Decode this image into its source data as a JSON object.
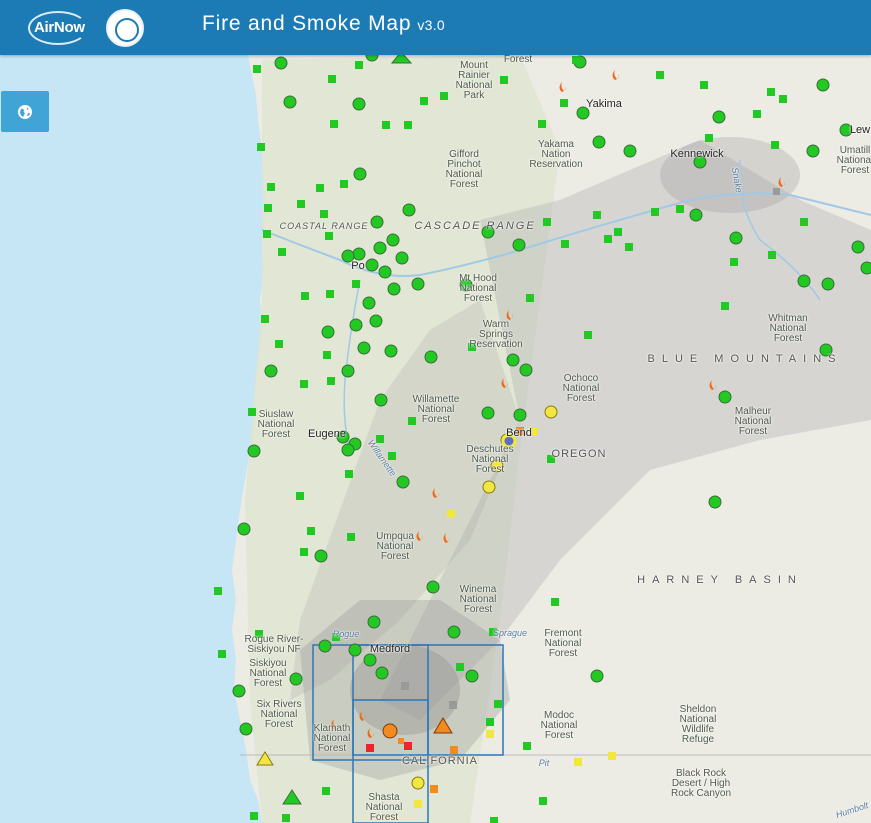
{
  "header": {
    "title": "Fire and Smoke Map",
    "version": "v3.0",
    "logo_airnow": "AirNow",
    "logo_agency": "agency seal"
  },
  "controls": {
    "basemap_button_icon": "globe-icon"
  },
  "colors": {
    "header": "#1c7bb4",
    "water": "#c6e6f5",
    "land": "#ecebe4",
    "smoke": "#a9a9a9",
    "good": "#22c922",
    "moderate": "#f2e640",
    "usg": "#f28a1e",
    "unhealthy": "#e8262b",
    "aoi": "#2b76b8"
  },
  "map": {
    "labels": [
      {
        "kind": "park",
        "text": "Mount\nRainier\nNational\nPark"
      },
      {
        "kind": "park",
        "text": "Snoqualmie\nNational\nForest"
      },
      {
        "kind": "city",
        "text": "Yakima"
      },
      {
        "kind": "park",
        "text": "Gifford\nPinchot\nNational\nForest"
      },
      {
        "kind": "park",
        "text": "Yakama\nNation\nReservation"
      },
      {
        "kind": "city",
        "text": "Kennewick"
      },
      {
        "kind": "city",
        "text": "Lew"
      },
      {
        "kind": "park",
        "text": "Umatill\nNational\nForest"
      },
      {
        "kind": "region2",
        "text": "COASTAL RANGE"
      },
      {
        "kind": "region2",
        "text": "CASCADE RANGE"
      },
      {
        "kind": "city",
        "text": "Po"
      },
      {
        "kind": "park",
        "text": "Mt Hood\nNational\nForest"
      },
      {
        "kind": "park",
        "text": "Warm\nSprings\nReservation"
      },
      {
        "kind": "park",
        "text": "Whitman\nNational\nForest"
      },
      {
        "kind": "region",
        "text": "BLUE MOUNTAINS"
      },
      {
        "kind": "park",
        "text": "Ochoco\nNational\nForest"
      },
      {
        "kind": "park",
        "text": "Malheur\nNational\nForest"
      },
      {
        "kind": "park",
        "text": "Siuslaw\nNational\nForest"
      },
      {
        "kind": "park",
        "text": "Willamette\nNational\nForest"
      },
      {
        "kind": "city",
        "text": "Eugene"
      },
      {
        "kind": "park",
        "text": "Deschutes\nNational\nForest"
      },
      {
        "kind": "state",
        "text": "OREGON"
      },
      {
        "kind": "park",
        "text": "Umpqua\nNational\nForest"
      },
      {
        "kind": "region",
        "text": "HARNEY BASIN"
      },
      {
        "kind": "park",
        "text": "Winema\nNational\nForest"
      },
      {
        "kind": "park",
        "text": "Fremont\nNational\nForest"
      },
      {
        "kind": "park",
        "text": "Rogue River-\nSiskiyou NF"
      },
      {
        "kind": "city",
        "text": "Medford"
      },
      {
        "kind": "park",
        "text": "Siskiyou\nNational\nForest"
      },
      {
        "kind": "park",
        "text": "Six Rivers\nNational\nForest"
      },
      {
        "kind": "park",
        "text": "Klamath\nNational\nForest"
      },
      {
        "kind": "park",
        "text": "Modoc\nNational\nForest"
      },
      {
        "kind": "park",
        "text": "Sheldon\nNational\nWildlife\nRefuge"
      },
      {
        "kind": "state",
        "text": "CALIFORNIA"
      },
      {
        "kind": "park",
        "text": "Shasta\nNational\nForest"
      },
      {
        "kind": "park",
        "text": "Black Rock\nDesert / High\nRock Canyon"
      },
      {
        "kind": "river",
        "text": "Snake"
      },
      {
        "kind": "river",
        "text": "Willamette"
      },
      {
        "kind": "river",
        "text": "Sprague"
      },
      {
        "kind": "river",
        "text": "Rogue"
      },
      {
        "kind": "river",
        "text": "Humbolt"
      },
      {
        "kind": "river",
        "text": "Pit"
      },
      {
        "kind": "city",
        "text": "Bend"
      }
    ]
  }
}
